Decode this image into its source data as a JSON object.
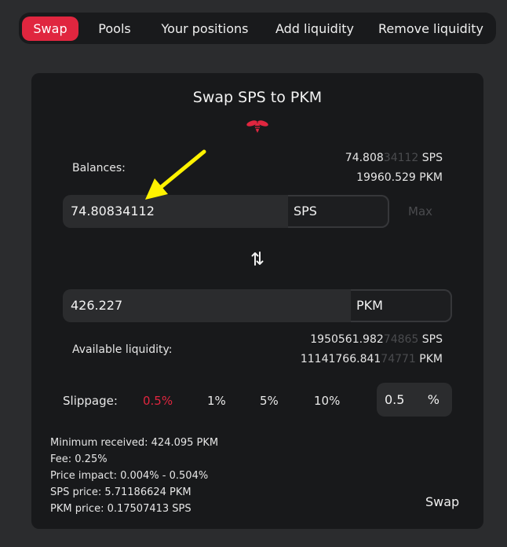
{
  "tabs": [
    {
      "label": "Swap",
      "active": true
    },
    {
      "label": "Pools",
      "active": false
    },
    {
      "label": "Your positions",
      "active": false
    },
    {
      "label": "Add liquidity",
      "active": false
    },
    {
      "label": "Remove liquidity",
      "active": false
    }
  ],
  "card": {
    "title": "Swap SPS to PKM",
    "balances_label": "Balances:",
    "balance_sps": {
      "main": "74.808",
      "faded": "34112",
      "unit": "SPS"
    },
    "balance_pkm": {
      "main": "19960.529",
      "faded": "",
      "unit": "PKM"
    },
    "from_input": {
      "value": "74.80834112",
      "currency": "SPS"
    },
    "max_label": "Max",
    "to_input": {
      "value": "426.227",
      "currency": "PKM"
    },
    "available_liquidity_label": "Available liquidity:",
    "liquidity_sps": {
      "main": "1950561.982",
      "faded": "74865",
      "unit": "SPS"
    },
    "liquidity_pkm": {
      "main": "11141766.841",
      "faded": "74771",
      "unit": "PKM"
    },
    "slippage": {
      "label": "Slippage:",
      "options": [
        "0.5%",
        "1%",
        "5%",
        "10%"
      ],
      "active_index": 0,
      "custom_value": "0.5",
      "custom_unit": "%"
    },
    "info": {
      "minimum_received": "Minimum received: 424.095 PKM",
      "fee": "Fee: 0.25%",
      "price_impact": "Price impact: 0.004% - 0.504%",
      "sps_price": "SPS price: 5.71186624 PKM",
      "pkm_price": "PKM price: 0.17507413 SPS"
    },
    "swap_button": "Swap"
  },
  "colors": {
    "accent": "#e0263f",
    "annotation_arrow": "#fff200",
    "background": "#2b2c2e",
    "card": "#18191b"
  },
  "icons": {
    "logo": "bee-logo-icon",
    "swap_direction": "swap-vertical-icon",
    "annotation": "yellow-arrow-annotation"
  }
}
